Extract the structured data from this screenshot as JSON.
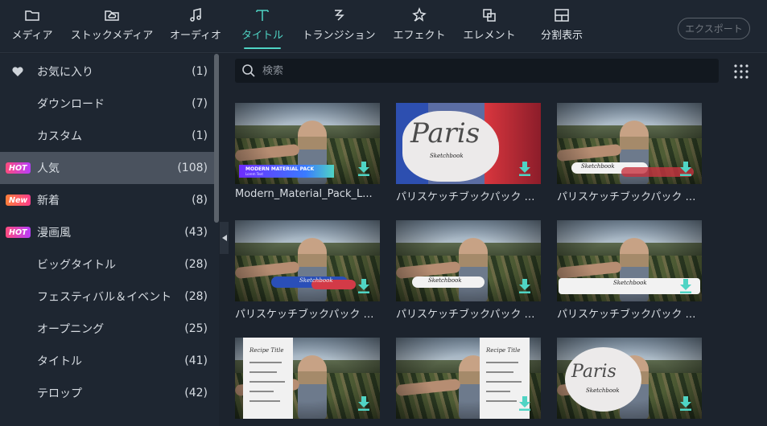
{
  "toolbar": {
    "tabs": [
      {
        "label": "メディア",
        "icon": "folder-icon"
      },
      {
        "label": "ストックメディア",
        "icon": "cloud-folder-icon"
      },
      {
        "label": "オーディオ",
        "icon": "music-note-icon"
      },
      {
        "label": "タイトル",
        "icon": "text-t-icon",
        "active": true
      },
      {
        "label": "トランジション",
        "icon": "transition-icon"
      },
      {
        "label": "エフェクト",
        "icon": "effect-star-icon"
      },
      {
        "label": "エレメント",
        "icon": "element-icon"
      },
      {
        "label": "分割表示",
        "icon": "split-screen-icon"
      }
    ],
    "export_label": "エクスポート"
  },
  "sidebar": {
    "items": [
      {
        "label": "お気に入り",
        "count": "(1)",
        "icon": "heart-icon"
      },
      {
        "label": "ダウンロード",
        "count": "(7)"
      },
      {
        "label": "カスタム",
        "count": "(1)"
      },
      {
        "label": "人気",
        "count": "(108)",
        "badge": "HOT",
        "active": true
      },
      {
        "label": "新着",
        "count": "(8)",
        "badge": "New"
      },
      {
        "label": "漫画風",
        "count": "(43)",
        "badge": "HOT"
      },
      {
        "label": "ビッグタイトル",
        "count": "(28)"
      },
      {
        "label": "フェスティバル＆イベント",
        "count": "(28)"
      },
      {
        "label": "オープニング",
        "count": "(25)"
      },
      {
        "label": "タイトル",
        "count": "(41)"
      },
      {
        "label": "テロップ",
        "count": "(42)"
      }
    ]
  },
  "search": {
    "placeholder": "検索"
  },
  "cards": [
    {
      "title": "Modern_Material_Pack_L...",
      "overlay_title": "MODERN MATERIAL PACK",
      "overlay_sub": "Lorem Text"
    },
    {
      "title": "パリスケッチブックパック タイト...",
      "overlay_title": "Paris",
      "overlay_sub": "Sketchbook"
    },
    {
      "title": "パリスケッチブックパック ローワ...",
      "overlay_title": "Sketchbook",
      "overlay_sub": "Lorem Text"
    },
    {
      "title": "パリスケッチブックパック ローワ...",
      "overlay_title": "Sketchbook",
      "overlay_sub": "Lorem Text"
    },
    {
      "title": "パリスケッチブックパック ローワ...",
      "overlay_title": "Sketchbook",
      "overlay_sub": "Lorem Text"
    },
    {
      "title": "パリスケッチブックパック ローワ...",
      "overlay_title": "Sketchbook",
      "overlay_sub": "Lorem Text"
    },
    {
      "title": "",
      "overlay_title": "Recipe Title"
    },
    {
      "title": "",
      "overlay_title": "Recipe Title"
    },
    {
      "title": "",
      "overlay_title": "Paris",
      "overlay_sub": "Sketchbook"
    }
  ],
  "colors": {
    "accent": "#4fd4c4",
    "hot_badge": "#ff4b7d",
    "active_row": "#4a525e"
  }
}
